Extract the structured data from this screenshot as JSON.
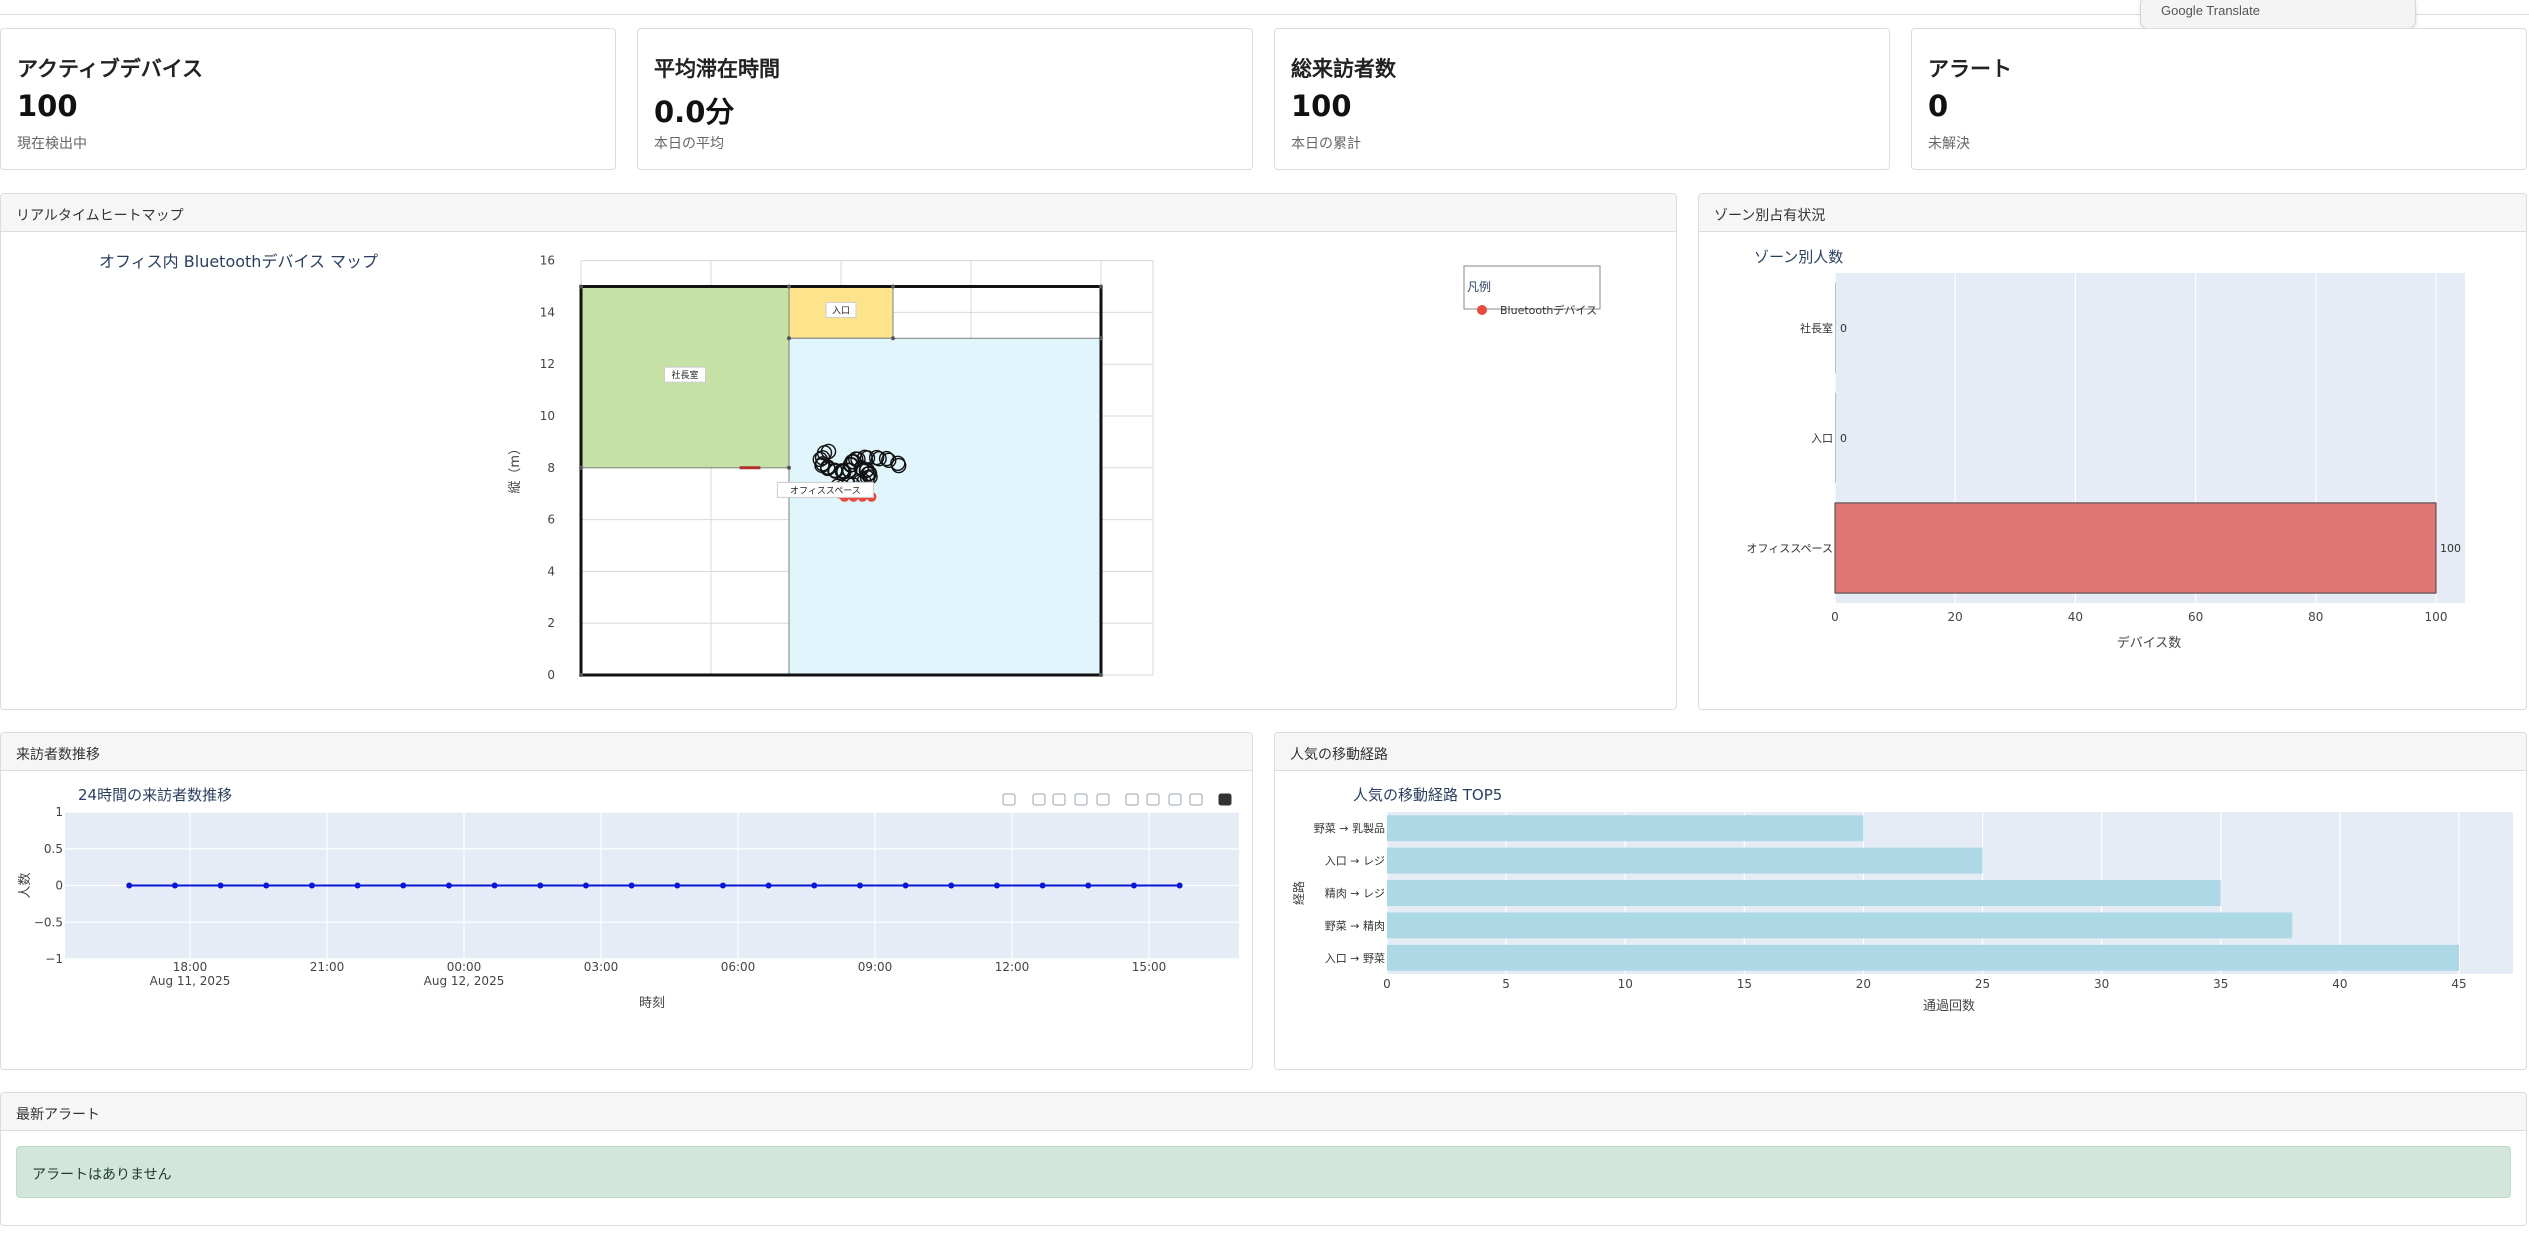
{
  "stats": [
    {
      "title": "アクティブデバイス",
      "value": "100",
      "sub": "現在検出中"
    },
    {
      "title": "平均滞在時間",
      "value": "0.0分",
      "sub": "本日の平均"
    },
    {
      "title": "総来訪者数",
      "value": "100",
      "sub": "本日の累計"
    },
    {
      "title": "アラート",
      "value": "0",
      "sub": "未解決"
    }
  ],
  "google_translate": "Google Translate",
  "panels": {
    "heatmap": "リアルタイムヒートマップ",
    "zone": "ゾーン別占有状況",
    "visitors": "来訪者数推移",
    "routes": "人気の移動経路",
    "alerts": "最新アラート"
  },
  "alerts": {
    "message": "アラートはありません"
  },
  "colors": {
    "plot_bg": "#e5ecf6",
    "zone_executive": "#c5e1a5",
    "zone_entrance": "#fde38c",
    "zone_office": "#e1f5fc",
    "device": "#e84a3f",
    "zone_bar": "#e07575",
    "route_bar": "#add8e6",
    "line": "#0a16d6",
    "alert_bg": "#d2e6dc"
  },
  "chart_data": [
    {
      "type": "scatter",
      "title": "オフィス内 Bluetoothデバイス マップ",
      "xlabel": "",
      "ylabel": "縦（m）",
      "xlim": [
        0,
        22
      ],
      "ylim": [
        0,
        16
      ],
      "yticks": [
        0,
        2,
        4,
        6,
        8,
        10,
        12,
        14,
        16
      ],
      "legend": {
        "title": "凡例",
        "items": [
          "Bluetoothデバイス"
        ],
        "placement": "top-right"
      },
      "zones": [
        {
          "name": "社長室",
          "x": [
            0,
            8
          ],
          "y": [
            8,
            15
          ]
        },
        {
          "name": "入口",
          "x": [
            8,
            12
          ],
          "y": [
            13,
            15
          ]
        },
        {
          "name": "オフィススペース",
          "x": [
            8,
            20
          ],
          "y": [
            0,
            13
          ]
        }
      ],
      "devices": {
        "center": [
          10,
          8
        ],
        "count": 100
      }
    },
    {
      "type": "bar",
      "orientation": "horizontal",
      "title": "ゾーン別人数",
      "xlabel": "デバイス数",
      "ylabel": "",
      "categories": [
        "社長室",
        "入口",
        "オフィススペース"
      ],
      "values": [
        0,
        0,
        100
      ],
      "xlim": [
        0,
        105
      ],
      "xticks": [
        0,
        20,
        40,
        60,
        80,
        100
      ]
    },
    {
      "type": "line",
      "title": "24時間の来訪者数推移",
      "xlabel": "時刻",
      "ylabel": "人数",
      "ylim": [
        -1,
        1
      ],
      "yticks": [
        "1",
        "0.5",
        "0",
        "−0.5",
        "−1"
      ],
      "xticks": [
        {
          "label": "18:00",
          "sub": "Aug 11, 2025"
        },
        {
          "label": "21:00",
          "sub": ""
        },
        {
          "label": "00:00",
          "sub": "Aug 12, 2025"
        },
        {
          "label": "03:00",
          "sub": ""
        },
        {
          "label": "06:00",
          "sub": ""
        },
        {
          "label": "09:00",
          "sub": ""
        },
        {
          "label": "12:00",
          "sub": ""
        },
        {
          "label": "15:00",
          "sub": ""
        }
      ],
      "x_hours_from_1800": [
        -1.33,
        -0.33,
        0.67,
        1.67,
        2.67,
        3.67,
        4.67,
        5.67,
        6.67,
        7.67,
        8.67,
        9.67,
        10.67,
        11.67,
        12.67,
        13.67,
        14.67,
        15.67,
        16.67,
        17.67,
        18.67,
        19.67,
        20.67,
        21.67
      ],
      "values": [
        0,
        0,
        0,
        0,
        0,
        0,
        0,
        0,
        0,
        0,
        0,
        0,
        0,
        0,
        0,
        0,
        0,
        0,
        0,
        0,
        0,
        0,
        0,
        0
      ],
      "grid": true
    },
    {
      "type": "bar",
      "orientation": "horizontal",
      "title": "人気の移動経路 TOP5",
      "xlabel": "通過回数",
      "ylabel": "経路",
      "categories": [
        "野菜 → 乳製品",
        "入口 → レジ",
        "精肉 → レジ",
        "野菜 → 精肉",
        "入口 → 野菜"
      ],
      "values": [
        20,
        25,
        35,
        38,
        45
      ],
      "xlim": [
        0,
        47
      ],
      "xticks": [
        0,
        5,
        10,
        15,
        20,
        25,
        30,
        35,
        40,
        45
      ]
    }
  ]
}
